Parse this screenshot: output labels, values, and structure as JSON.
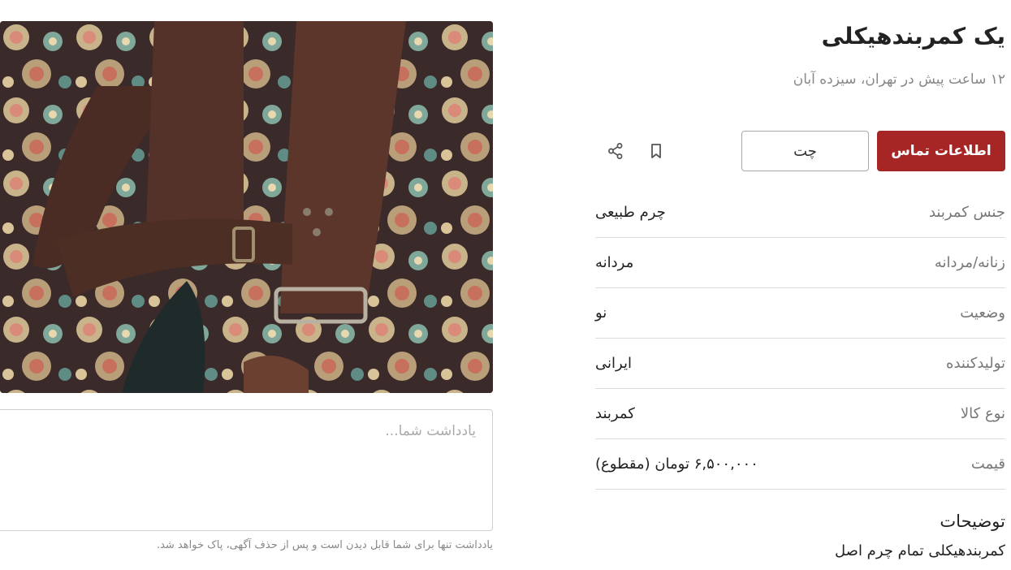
{
  "ad": {
    "title": "یک کمربندهیکلی",
    "subtitle": "۱۲ ساعت پیش در تهران، سیزده آبان"
  },
  "actions": {
    "contact_label": "اطلاعات تماس",
    "chat_label": "چت",
    "bookmark_icon": "bookmark-icon",
    "share_icon": "share-icon"
  },
  "attributes": [
    {
      "label": "جنس کمربند",
      "value": "چرم طبیعی"
    },
    {
      "label": "زنانه/مردانه",
      "value": "مردانه"
    },
    {
      "label": "وضعیت",
      "value": "نو"
    },
    {
      "label": "تولیدکننده",
      "value": "ایرانی"
    },
    {
      "label": "نوع کالا",
      "value": "کمربند"
    },
    {
      "label": "قیمت",
      "value": "۶,۵۰۰,۰۰۰ تومان (مقطوع)"
    }
  ],
  "description": {
    "title": "توضیحات",
    "text": "کمربندهیکلی تمام چرم اصل"
  },
  "note": {
    "placeholder": "یادداشت شما...",
    "hint": "یادداشت تنها برای شما قابل دیدن است و پس از حذف آگهی، پاک خواهد شد."
  },
  "colors": {
    "accent": "#a62626",
    "border": "#dcdcdc"
  }
}
